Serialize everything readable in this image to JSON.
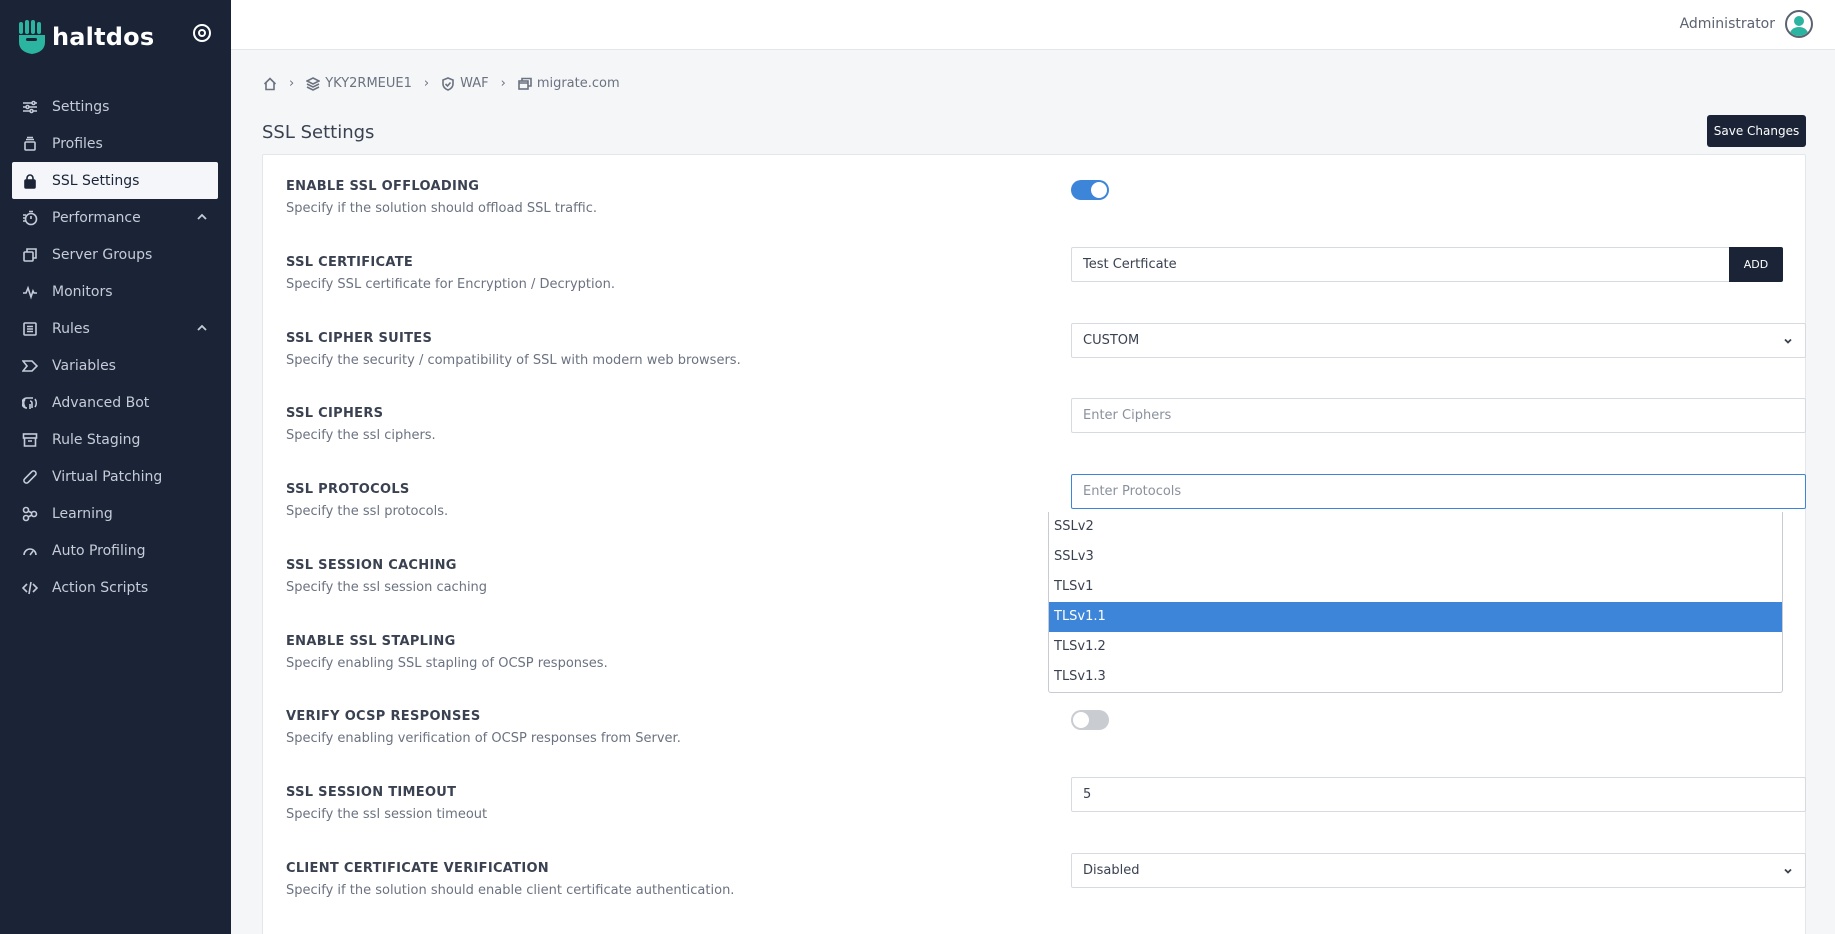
{
  "brand": {
    "name": "haltdos"
  },
  "sidebar": {
    "items": [
      {
        "label": "Settings",
        "icon": "sliders-icon",
        "active": false,
        "expandable": false
      },
      {
        "label": "Profiles",
        "icon": "stack-icon",
        "active": false,
        "expandable": false
      },
      {
        "label": "SSL Settings",
        "icon": "lock-icon",
        "active": true,
        "expandable": false
      },
      {
        "label": "Performance",
        "icon": "stopwatch-icon",
        "active": false,
        "expandable": true
      },
      {
        "label": "Server Groups",
        "icon": "copy-icon",
        "active": false,
        "expandable": false
      },
      {
        "label": "Monitors",
        "icon": "pulse-icon",
        "active": false,
        "expandable": false
      },
      {
        "label": "Rules",
        "icon": "list-icon",
        "active": false,
        "expandable": true
      },
      {
        "label": "Variables",
        "icon": "tag-icon",
        "active": false,
        "expandable": false
      },
      {
        "label": "Advanced Bot",
        "icon": "fingerprint-icon",
        "active": false,
        "expandable": false
      },
      {
        "label": "Rule Staging",
        "icon": "archive-icon",
        "active": false,
        "expandable": false
      },
      {
        "label": "Virtual Patching",
        "icon": "bandage-icon",
        "active": false,
        "expandable": false
      },
      {
        "label": "Learning",
        "icon": "nodes-icon",
        "active": false,
        "expandable": false
      },
      {
        "label": "Auto Profiling",
        "icon": "gauge-icon",
        "active": false,
        "expandable": false
      },
      {
        "label": "Action Scripts",
        "icon": "code-icon",
        "active": false,
        "expandable": false
      }
    ]
  },
  "topbar": {
    "user_name": "Administrator"
  },
  "breadcrumb": {
    "items": [
      {
        "label": "",
        "icon": "home-icon"
      },
      {
        "label": "YKY2RMEUE1",
        "icon": "layers-icon"
      },
      {
        "label": "WAF",
        "icon": "shield-icon"
      },
      {
        "label": "migrate.com",
        "icon": "windows-icon"
      }
    ]
  },
  "page": {
    "title": "SSL Settings",
    "save_label": "Save Changes"
  },
  "settings": {
    "ssl_offloading": {
      "title": "ENABLE SSL OFFLOADING",
      "desc": "Specify if the solution should offload SSL traffic.",
      "enabled": true
    },
    "ssl_certificate": {
      "title": "SSL CERTIFICATE",
      "desc": "Specify SSL certificate for Encryption / Decryption.",
      "value": "Test Certficate",
      "add_label": "ADD"
    },
    "cipher_suites": {
      "title": "SSL CIPHER SUITES",
      "desc": "Specify the security / compatibility of SSL with modern web browsers.",
      "value": "CUSTOM"
    },
    "ciphers": {
      "title": "SSL CIPHERS",
      "desc": "Specify the ssl ciphers.",
      "placeholder": "Enter Ciphers"
    },
    "protocols": {
      "title": "SSL PROTOCOLS",
      "desc": "Specify the ssl protocols.",
      "placeholder": "Enter Protocols",
      "options": [
        "SSLv2",
        "SSLv3",
        "TLSv1",
        "TLSv1.1",
        "TLSv1.2",
        "TLSv1.3"
      ],
      "highlighted": "TLSv1.1"
    },
    "session_caching": {
      "title": "SSL SESSION CACHING",
      "desc": "Specify the ssl session caching"
    },
    "stapling": {
      "title": "ENABLE SSL STAPLING",
      "desc": "Specify enabling SSL stapling of OCSP responses."
    },
    "verify_ocsp": {
      "title": "VERIFY OCSP RESPONSES",
      "desc": "Specify enabling verification of OCSP responses from Server.",
      "enabled": false
    },
    "session_timeout": {
      "title": "SSL SESSION TIMEOUT",
      "desc": "Specify the ssl session timeout",
      "value": "5"
    },
    "client_cert": {
      "title": "CLIENT CERTIFICATE VERIFICATION",
      "desc": "Specify if the solution should enable client certificate authentication.",
      "value": "Disabled"
    }
  },
  "colors": {
    "sidebar_bg": "#1b2437",
    "accent": "#3d85d8",
    "brand_teal": "#2bb5a0"
  }
}
